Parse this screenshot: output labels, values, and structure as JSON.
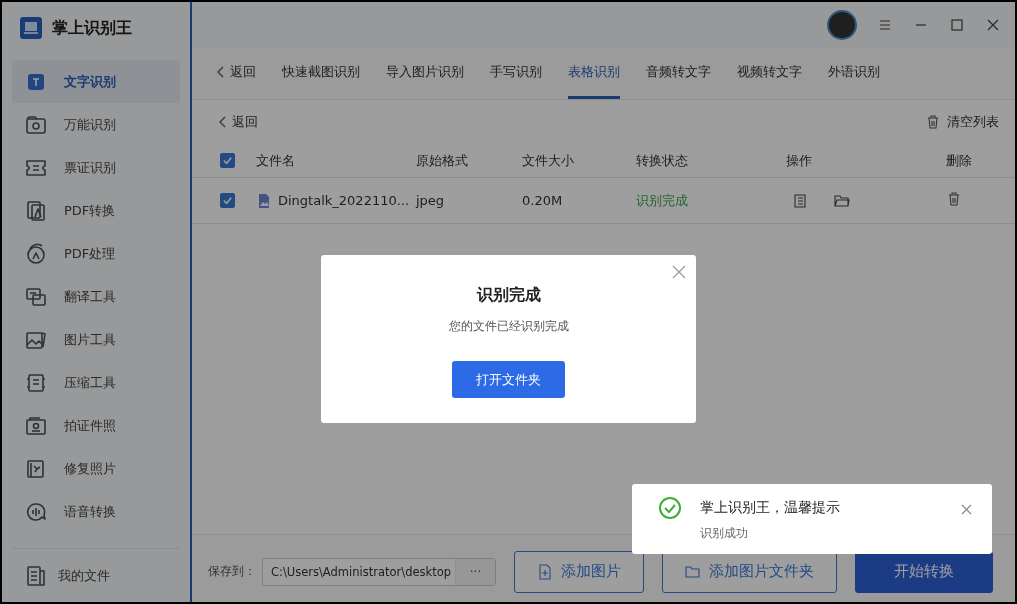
{
  "app": {
    "title": "掌上识别王"
  },
  "sidebar": {
    "items": [
      {
        "label": "文字识别",
        "selected": true
      },
      {
        "label": "万能识别",
        "selected": false
      },
      {
        "label": "票证识别",
        "selected": false
      },
      {
        "label": "PDF转换",
        "selected": false
      },
      {
        "label": "PDF处理",
        "selected": false
      },
      {
        "label": "翻译工具",
        "selected": false
      },
      {
        "label": "图片工具",
        "selected": false
      },
      {
        "label": "压缩工具",
        "selected": false
      },
      {
        "label": "拍证件照",
        "selected": false
      },
      {
        "label": "修复照片",
        "selected": false
      },
      {
        "label": "语音转换",
        "selected": false
      }
    ],
    "footer": {
      "label": "我的文件"
    }
  },
  "tabs": {
    "back": "返回",
    "items": [
      {
        "label": "快速截图识别",
        "selected": false
      },
      {
        "label": "导入图片识别",
        "selected": false
      },
      {
        "label": "手写识别",
        "selected": false
      },
      {
        "label": "表格识别",
        "selected": true
      },
      {
        "label": "音频转文字",
        "selected": false
      },
      {
        "label": "视频转文字",
        "selected": false
      },
      {
        "label": "外语识别",
        "selected": false
      }
    ]
  },
  "toolbar": {
    "back": "返回",
    "clear": "清空列表"
  },
  "table": {
    "all_checked": true,
    "columns": [
      "文件名",
      "原始格式",
      "文件大小",
      "转换状态",
      "操作",
      "删除"
    ],
    "rows": [
      {
        "checked": true,
        "file_name": "Dingtalk_2022110...",
        "format": "jpeg",
        "size": "0.20M",
        "status": "识别完成"
      }
    ]
  },
  "bottom": {
    "save_label": "保存到：",
    "path": "C:\\Users\\Administrator\\desktop",
    "browse": "···",
    "buttons": [
      {
        "label": "添加图片",
        "kind": "outline"
      },
      {
        "label": "添加图片文件夹",
        "kind": "outline"
      },
      {
        "label": "开始转换",
        "kind": "primary"
      }
    ]
  },
  "dialog": {
    "title": "识别完成",
    "message": "您的文件已经识别完成",
    "button": "打开文件夹"
  },
  "toast": {
    "title": "掌上识别王，温馨提示",
    "message": "识别成功"
  }
}
